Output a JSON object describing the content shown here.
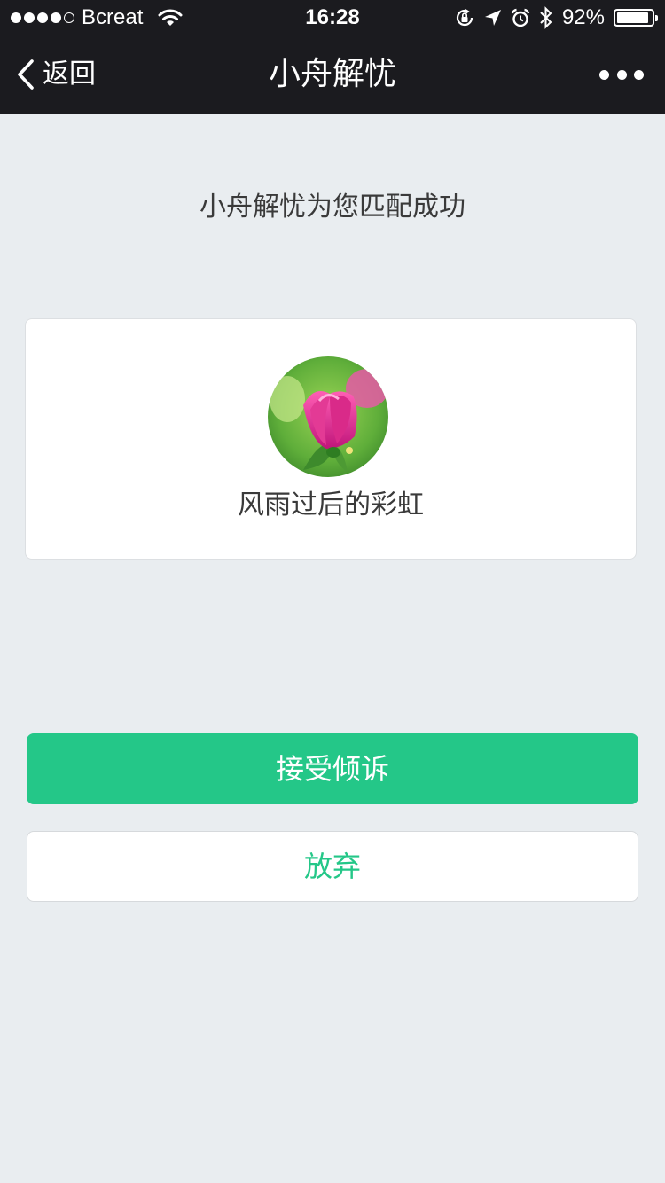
{
  "status_bar": {
    "carrier": "Bcreat",
    "time": "16:28",
    "battery_percent_text": "92%",
    "battery_level": 0.92,
    "signal_bars_filled": 4,
    "signal_bars_total": 5,
    "icons": [
      "wifi-icon",
      "rotation-lock-icon",
      "location-arrow-icon",
      "alarm-icon",
      "bluetooth-icon",
      "battery-icon"
    ]
  },
  "nav": {
    "back_label": "返回",
    "title": "小舟解忧",
    "more_icon": "more-dots-icon"
  },
  "main": {
    "headline": "小舟解忧为您匹配成功",
    "match_card": {
      "avatar": "pink-flower-avatar",
      "nickname": "风雨过后的彩虹"
    },
    "accept_button_label": "接受倾诉",
    "give_up_button_label": "放弃"
  },
  "colors": {
    "header_background": "#1b1b1f",
    "page_background": "#e9edf0",
    "accent_green": "#24c788"
  }
}
